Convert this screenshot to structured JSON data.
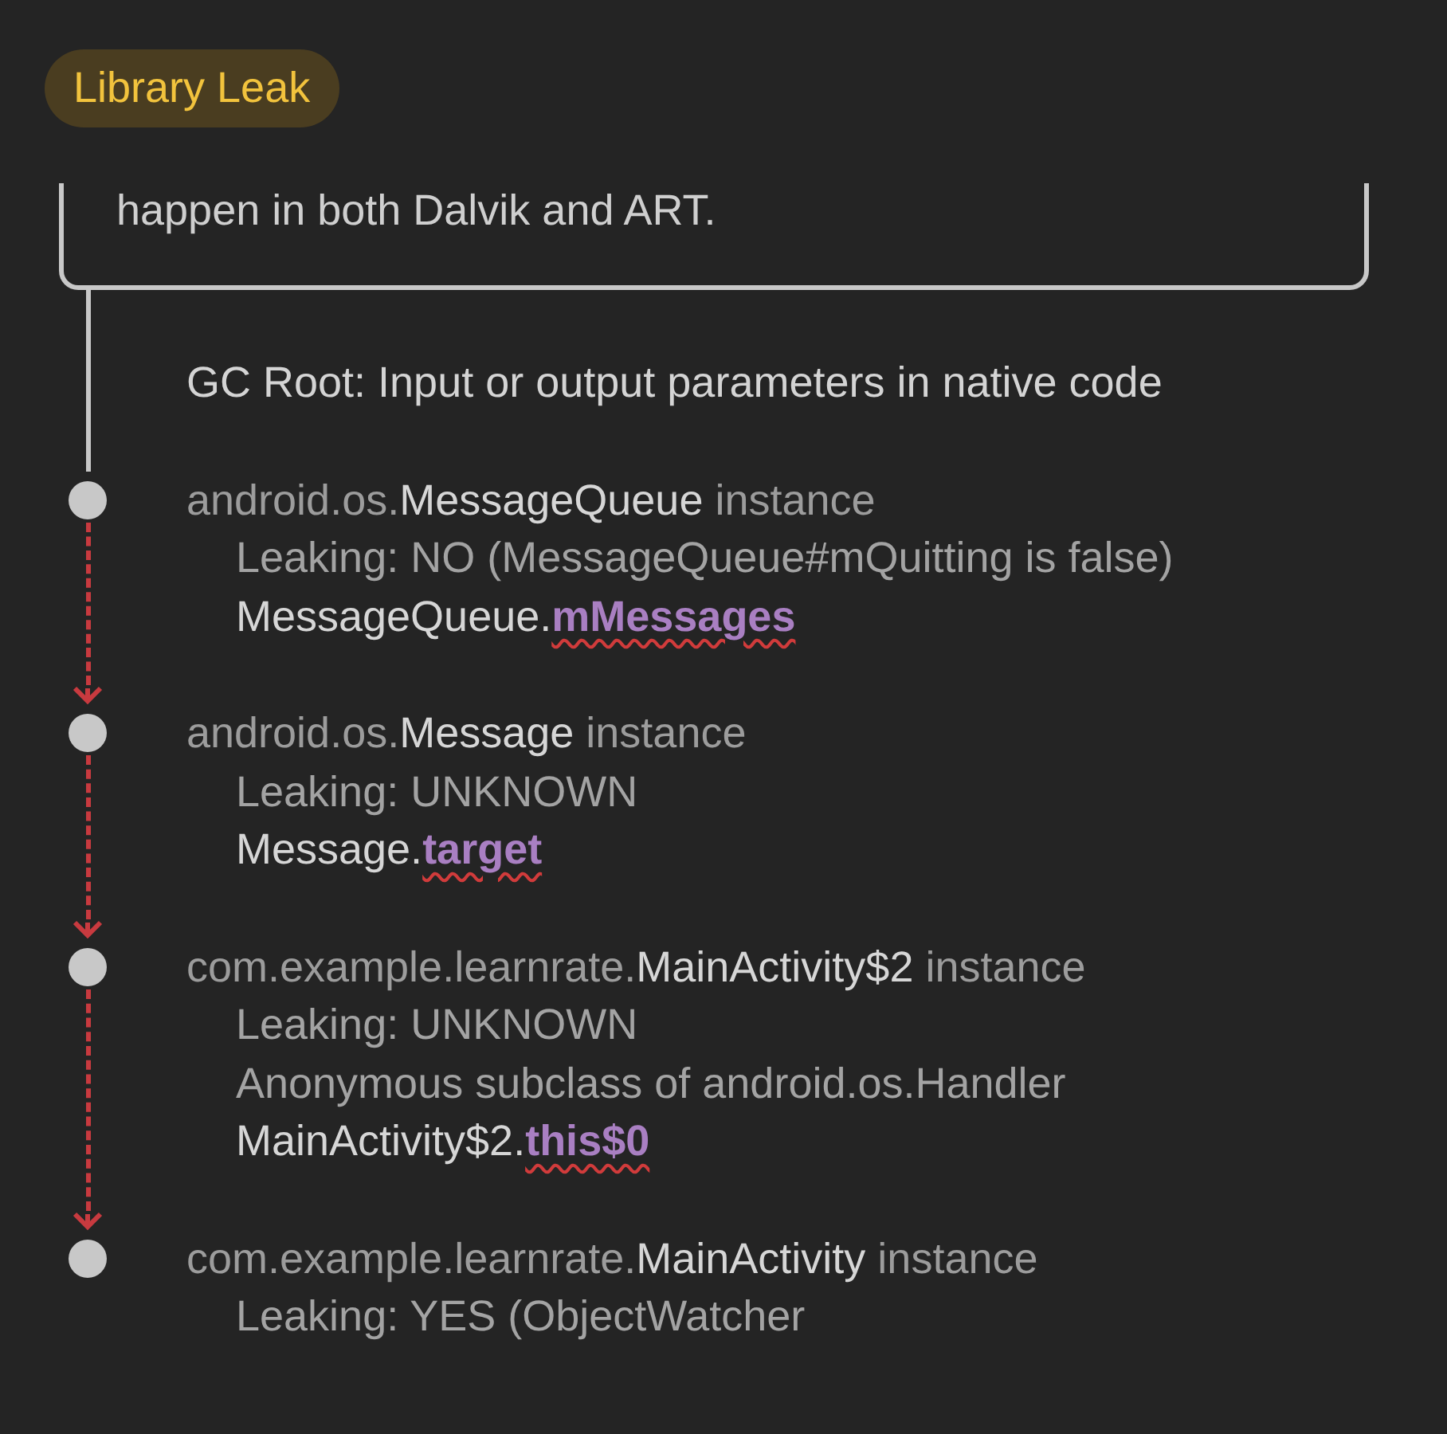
{
  "badge": "Library Leak",
  "description_tail": "happen in both Dalvik and ART.",
  "gc_root": "GC Root: Input or output parameters in native code",
  "nodes": [
    {
      "package": "android.os.",
      "class_name": "MessageQueue",
      "suffix": " instance",
      "details": [
        "Leaking: NO (MessageQueue#mQuitting is false)"
      ],
      "reference": {
        "owner": "MessageQueue.",
        "field": "mMessages",
        "suspect": true
      }
    },
    {
      "package": "android.os.",
      "class_name": "Message",
      "suffix": " instance",
      "details": [
        "Leaking: UNKNOWN"
      ],
      "reference": {
        "owner": "Message.",
        "field": "target",
        "suspect": true
      }
    },
    {
      "package": "com.example.learnrate.",
      "class_name": "MainActivity$2",
      "suffix": " instance",
      "details": [
        "Leaking: UNKNOWN",
        "Anonymous subclass of android.os.Handler"
      ],
      "reference": {
        "owner": "MainActivity$2.",
        "field": "this$0",
        "suspect": true
      }
    },
    {
      "package": "com.example.learnrate.",
      "class_name": "MainActivity",
      "suffix": " instance",
      "details": [
        "Leaking: YES (ObjectWatcher"
      ]
    }
  ]
}
